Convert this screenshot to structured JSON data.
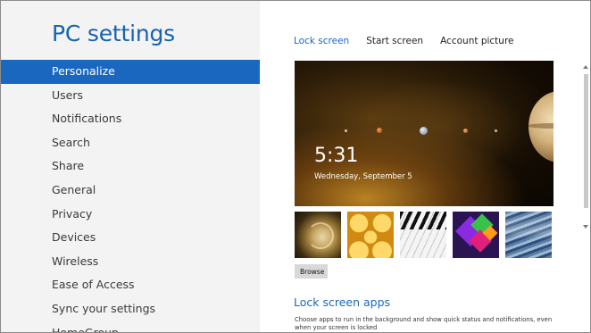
{
  "app": {
    "title": "PC settings"
  },
  "sidebar": {
    "items": [
      {
        "label": "Personalize",
        "selected": true
      },
      {
        "label": "Users"
      },
      {
        "label": "Notifications"
      },
      {
        "label": "Search"
      },
      {
        "label": "Share"
      },
      {
        "label": "General"
      },
      {
        "label": "Privacy"
      },
      {
        "label": "Devices"
      },
      {
        "label": "Wireless"
      },
      {
        "label": "Ease of Access"
      },
      {
        "label": "Sync your settings"
      },
      {
        "label": "HomeGroup"
      }
    ]
  },
  "tabs": [
    {
      "label": "Lock screen",
      "active": true
    },
    {
      "label": "Start screen"
    },
    {
      "label": "Account picture"
    }
  ],
  "lock_preview": {
    "time": "5:31",
    "date": "Wednesday, September 5"
  },
  "thumbnails": [
    {
      "icon": "nautilus-shell-image"
    },
    {
      "icon": "honeycomb-image"
    },
    {
      "icon": "piano-keys-image"
    },
    {
      "icon": "abstract-shapes-image"
    },
    {
      "icon": "tunnel-image"
    }
  ],
  "browse_label": "Browse",
  "lock_screen_apps": {
    "title": "Lock screen apps",
    "description": "Choose apps to run in the background and show quick status and notifications, even when your screen is locked"
  },
  "colors": {
    "accent": "#1a67c0",
    "sidebar_bg": "#f3f3f3"
  }
}
